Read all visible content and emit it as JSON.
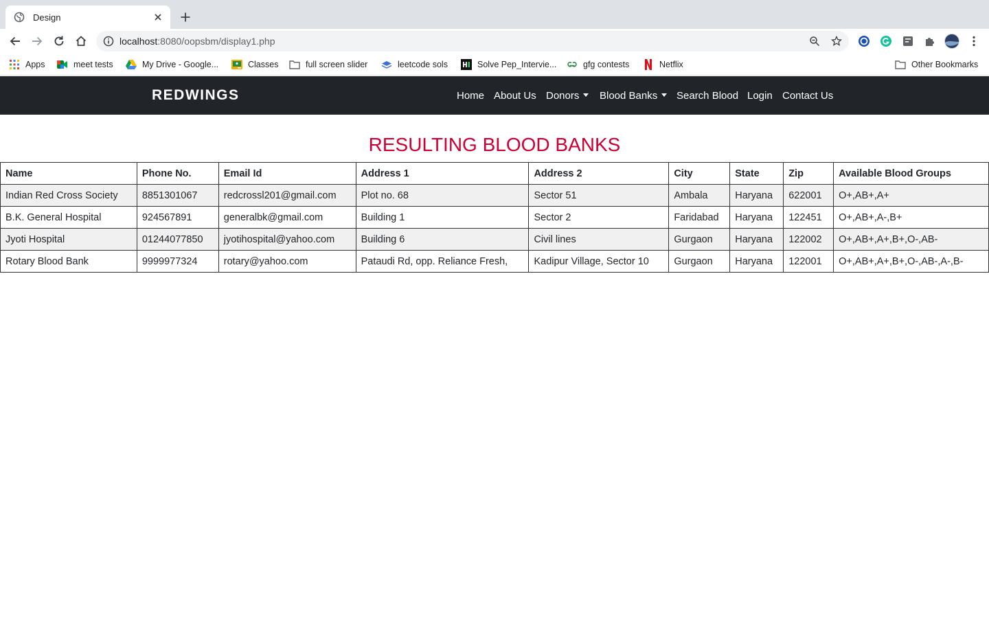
{
  "browser": {
    "tab_title": "Design",
    "url_host": "localhost",
    "url_path": ":8080/oopsbm/display1.php",
    "bookmarks": [
      {
        "label": "Apps",
        "icon": "apps-grid-icon"
      },
      {
        "label": "meet tests",
        "icon": "google-meet-icon"
      },
      {
        "label": "My Drive - Google...",
        "icon": "google-drive-icon"
      },
      {
        "label": "Classes",
        "icon": "classroom-icon"
      },
      {
        "label": "full screen slider",
        "icon": "folder-icon"
      },
      {
        "label": "leetcode sols",
        "icon": "layers-icon"
      },
      {
        "label": "Solve Pep_Intervie...",
        "icon": "hackerrank-icon"
      },
      {
        "label": "gfg contests",
        "icon": "gfg-icon"
      },
      {
        "label": "Netflix",
        "icon": "netflix-icon"
      }
    ],
    "other_bookmarks": "Other Bookmarks"
  },
  "navbar": {
    "brand": "REDWINGS",
    "items": [
      {
        "label": "Home",
        "dropdown": false
      },
      {
        "label": "About Us",
        "dropdown": false
      },
      {
        "label": "Donors",
        "dropdown": true
      },
      {
        "label": "Blood Banks",
        "dropdown": true
      },
      {
        "label": "Search Blood",
        "dropdown": false
      },
      {
        "label": "Login",
        "dropdown": false
      },
      {
        "label": "Contact Us",
        "dropdown": false
      }
    ]
  },
  "page": {
    "heading": "RESULTING BLOOD BANKS",
    "heading_color": "#cc0033"
  },
  "table": {
    "columns": [
      "Name",
      "Phone No.",
      "Email Id",
      "Address 1",
      "Address 2",
      "City",
      "State",
      "Zip",
      "Available Blood Groups"
    ],
    "rows": [
      [
        "Indian Red Cross Society",
        "8851301067",
        "redcrossl201@gmail.com",
        "Plot no. 68",
        "Sector 51",
        "Ambala",
        "Haryana",
        "622001",
        "O+,AB+,A+"
      ],
      [
        "B.K. General Hospital",
        "924567891",
        "generalbk@gmail.com",
        "Building 1",
        "Sector 2",
        "Faridabad",
        "Haryana",
        "122451",
        "O+,AB+,A-,B+"
      ],
      [
        "Jyoti Hospital",
        "01244077850",
        "jyotihospital@yahoo.com",
        "Building 6",
        "Civil lines",
        "Gurgaon",
        "Haryana",
        "122002",
        "O+,AB+,A+,B+,O-,AB-"
      ],
      [
        "Rotary Blood Bank",
        "9999977324",
        "rotary@yahoo.com",
        "Pataudi Rd, opp. Reliance Fresh,",
        "Kadipur Village, Sector 10",
        "Gurgaon",
        "Haryana",
        "122001",
        "O+,AB+,A+,B+,O-,AB-,A-,B-"
      ]
    ]
  }
}
